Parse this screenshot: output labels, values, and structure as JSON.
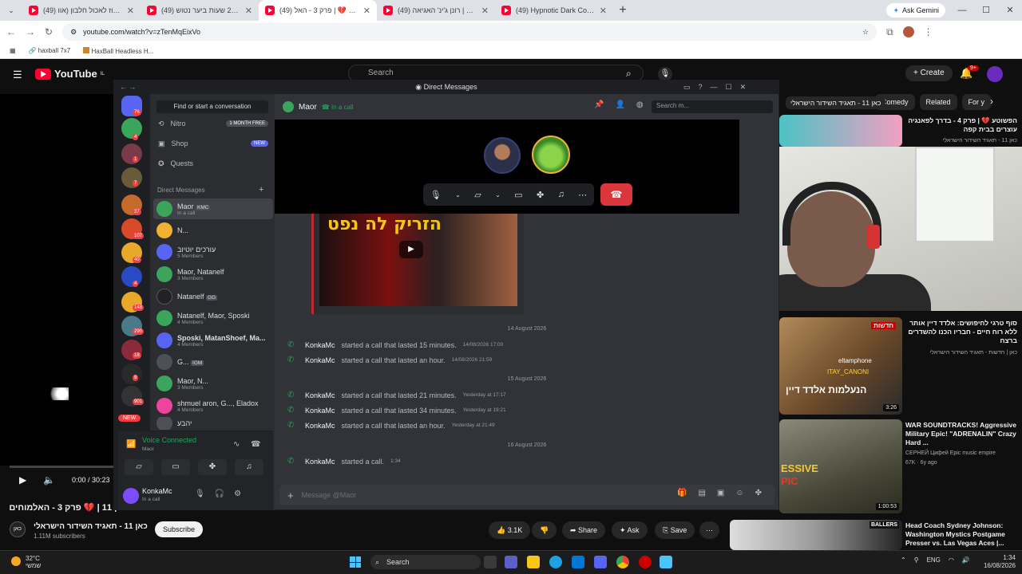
{
  "browser": {
    "tabs": [
      {
        "title": "(49) אל תעוז לאכול חלבון (אוו",
        "active": false
      },
      {
        "title": "(49) שורדים 24 שעות ביער נטוש",
        "active": false
      },
      {
        "title": "(49) הפשוטע 💔 | פרק 3 - האל",
        "active": true
      },
      {
        "title": "(49) עננה 2 | רונן ג'ינ' האגיאה",
        "active": false
      },
      {
        "title": "(49) Hypnotic Dark Code | Futu",
        "active": false
      }
    ],
    "new_tab": "+",
    "gemini_label": "Ask Gemini",
    "url": "youtube.com/watch?v=zTenMqEixVo",
    "bookmarks": [
      "haxball 7x7",
      "HaxBall Headless H..."
    ]
  },
  "youtube": {
    "logo_text": "YouTube",
    "logo_region": "IL",
    "search_placeholder": "Search",
    "create_label": "Create",
    "notif_count": "9+",
    "player": {
      "time": "0:00 / 30:23"
    },
    "video_title": "כאן 11 | 💔 פרק 3 - האלמוחים",
    "channel": {
      "icon_text": "כאן",
      "name": "כאן 11 - תאגיד השידור הישראלי",
      "subs": "1.11M subscribers"
    },
    "subscribe_label": "Subscribe",
    "likes": "3.1K",
    "share_label": "Share",
    "ask_label": "Ask",
    "save_label": "Save",
    "chips": [
      "כאן 11 - תאגיד השידור הישראלי",
      "Comedy",
      "Related",
      "For y"
    ],
    "related": [
      {
        "title": "הפשוטע 💔 | פרק 4 - בדרך לפאנגיה עוצרים בבית קפה",
        "meta": "כאן 11 - תאגיד השידור הישראלי",
        "duration": ""
      },
      {
        "title": "סוף טרגי לחיפושים: אלדד דיין אותר ללא רוח חיים - חבריו הכנו להשדרים ברצח",
        "meta": "כאן | חדשות - תאגיד השידור הישראלי",
        "duration": "3:26"
      },
      {
        "title": "WAR SOUNDTRACKS! Aggressive Military Epic! \"ADRENALIN\" Crazy Hard ...",
        "meta": "СЕРНЕЙ Цифей Epic music empire",
        "meta2": "67K · 6y ago",
        "duration": "1:00:53"
      },
      {
        "title": "Head Coach Sydney Johnson: Washington Mystics Postgame Presser vs. Las Vegas Aces |...",
        "meta": "",
        "duration": ""
      }
    ],
    "thumb_text": [
      "חדשות",
      "eltamphone",
      "ITAY_CANONI",
      "הנעלמות אלדד דיין",
      "ESSIVE",
      "PIC",
      "BALLERS"
    ]
  },
  "discord": {
    "title": "Direct Messages",
    "find_label": "Find or start a conversation",
    "nav": [
      {
        "label": "Nitro",
        "badge": "1 MONTH FREE"
      },
      {
        "label": "Shop",
        "badge": "NEW"
      },
      {
        "label": "Quests",
        "badge": ""
      }
    ],
    "dm_header": "Direct Messages",
    "dms": [
      {
        "name": "Maor",
        "tag": "KMC",
        "sub": "In a call",
        "color": "#3ba55c"
      },
      {
        "name": "N...",
        "tag": "",
        "sub": "",
        "color": "#f0b232"
      },
      {
        "name": "עורכים יוטיוב",
        "tag": "",
        "sub": "5 Members",
        "color": "#5865f2"
      },
      {
        "name": "Maor, Natanelf",
        "tag": "",
        "sub": "3 Members",
        "color": "#3ba55c"
      },
      {
        "name": "Natanelf",
        "tag": "GG",
        "sub": "",
        "color": "#222"
      },
      {
        "name": "Natanelf, Maor, Sposki",
        "tag": "",
        "sub": "4 Members",
        "color": "#3ba55c"
      },
      {
        "name": "Sposki, MatanShoef, Ma...",
        "tag": "",
        "sub": "4 Members",
        "color": "#5865f2"
      },
      {
        "name": "G...",
        "tag": "IGM",
        "sub": "",
        "color": "#4e5058"
      },
      {
        "name": "Maor, N...",
        "tag": "",
        "sub": "3 Members",
        "color": "#3ba55c"
      },
      {
        "name": "shmuel aron, G..., Eladox",
        "tag": "",
        "sub": "4 Members",
        "color": "#eb459e"
      },
      {
        "name": "יהבע",
        "tag": "",
        "sub": "",
        "color": "#4e5058"
      }
    ],
    "server_badges": [
      "76",
      "4",
      "1",
      "7",
      "37",
      "107",
      "40",
      "4",
      "148",
      "290",
      "18",
      "9",
      "901"
    ],
    "new_badge": "NEW",
    "voice": {
      "status": "Voice Connected",
      "channel": "Maor"
    },
    "user": {
      "name": "KonkaMc",
      "status": "In a call"
    },
    "chat": {
      "name": "Maor",
      "status": "In a call",
      "search_placeholder": "Search m...",
      "embed_text": "הזריק לה נפט",
      "groups": [
        {
          "date": "14 August 2026",
          "rows": [
            {
              "user": "KonkaMc",
              "text": "started a call that lasted 15 minutes.",
              "time": "14/08/2026 17:00"
            },
            {
              "user": "KonkaMc",
              "text": "started a call that lasted an hour.",
              "time": "14/08/2026 21:59"
            }
          ]
        },
        {
          "date": "15 August 2026",
          "rows": [
            {
              "user": "KonkaMc",
              "text": "started a call that lasted 21 minutes.",
              "time": "Yesterday at 17:17"
            },
            {
              "user": "KonkaMc",
              "text": "started a call that lasted 34 minutes.",
              "time": "Yesterday at 19:21"
            },
            {
              "user": "KonkaMc",
              "text": "started a call that lasted an hour.",
              "time": "Yesterday at 21:49"
            }
          ]
        },
        {
          "date": "16 August 2026",
          "rows": [
            {
              "user": "KonkaMc",
              "text": "started a call.",
              "time": "1:34"
            }
          ]
        }
      ],
      "message_placeholder": "Message @Maor"
    }
  },
  "taskbar": {
    "temp": "32°C",
    "weather": "שמשי",
    "search_placeholder": "Search",
    "lang": "ENG",
    "time": "1:34",
    "date": "16/08/2026"
  }
}
